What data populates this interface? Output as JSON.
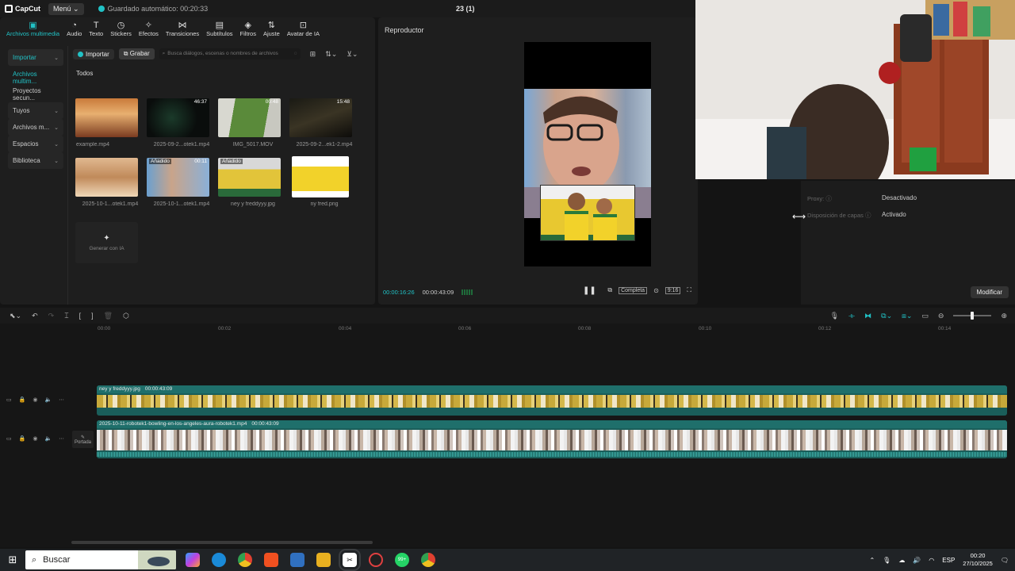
{
  "titlebar": {
    "logo": "CapCut",
    "menu": "Menú",
    "autosave": "Guardado automático: 00:20:33",
    "project": "23 (1)"
  },
  "toolbar": [
    {
      "icon": "media-icon",
      "label": "Archivos multimedia",
      "active": true
    },
    {
      "icon": "audio-icon",
      "label": "Audio"
    },
    {
      "icon": "text-icon",
      "label": "Texto"
    },
    {
      "icon": "stickers-icon",
      "label": "Stickers"
    },
    {
      "icon": "effects-icon",
      "label": "Efectos"
    },
    {
      "icon": "transitions-icon",
      "label": "Transiciones"
    },
    {
      "icon": "subtitles-icon",
      "label": "Subtítulos"
    },
    {
      "icon": "filters-icon",
      "label": "Filtros"
    },
    {
      "icon": "adjust-icon",
      "label": "Ajuste"
    },
    {
      "icon": "ai-avatar-icon",
      "label": "Avatar de IA"
    }
  ],
  "sidebar": {
    "items": [
      {
        "label": "Importar",
        "chev": "⌄"
      },
      {
        "label": "Archivos multim..."
      },
      {
        "label": "Proyectos secun..."
      },
      {
        "label": "Tuyos",
        "chev": "⌄"
      },
      {
        "label": "Archivos m...",
        "chev": "⌄"
      },
      {
        "label": "Espacios",
        "chev": "⌄"
      },
      {
        "label": "Biblioteca",
        "chev": "⌄"
      }
    ]
  },
  "media": {
    "import_btn": "Importar",
    "record_btn": "Grabar",
    "search_placeholder": "Busca diálogos, escenas o nombres de archivos",
    "section": "Todos",
    "items": [
      {
        "name": "example.mp4",
        "duration": "",
        "added": ""
      },
      {
        "name": "2025-09-2...otek1.mp4",
        "duration": "46:37",
        "added": ""
      },
      {
        "name": "IMG_5017.MOV",
        "duration": "00:48",
        "added": ""
      },
      {
        "name": "2025-09-2...ek1-2.mp4",
        "duration": "15:48",
        "added": ""
      },
      {
        "name": "2025-10-1...otek1.mp4",
        "duration": "",
        "added": ""
      },
      {
        "name": "2025-10-1...otek1.mp4",
        "duration": "00:11",
        "added": "Añadido"
      },
      {
        "name": "ney y freddyyy.jpg",
        "duration": "",
        "added": "Añadido"
      },
      {
        "name": "ny fred.png",
        "duration": "",
        "added": ""
      }
    ],
    "generate_ai": "Generar con IA"
  },
  "player": {
    "title": "Reproductor",
    "current_time": "00:00:16:26",
    "total_time": "00:00:43:09",
    "full_label": "Completa",
    "ratio_label": "9:16"
  },
  "properties": {
    "proxy_key": "Proxy: ⓘ",
    "proxy_val": "Desactivado",
    "layers_key": "Disposición de capas ⓘ",
    "layers_val": "Activado",
    "modify": "Modificar"
  },
  "timeline": {
    "ticks": [
      "00:00",
      "00:02",
      "00:04",
      "00:06",
      "00:08",
      "00:10",
      "00:12",
      "00:14"
    ],
    "cover_label": "Portada",
    "clip1": {
      "name": "ney y freddyyy.jpg",
      "duration": "00:00:43:09"
    },
    "clip2": {
      "name": "2025-10-11-robotek1-bowling-en-los-angeles-aura-robotek1.mp4",
      "duration": "00:00:43:09"
    }
  },
  "taskbar": {
    "search": "Buscar",
    "lang": "ESP",
    "time": "00:20",
    "date": "27/10/2025",
    "whatsapp_badge": "99+"
  }
}
